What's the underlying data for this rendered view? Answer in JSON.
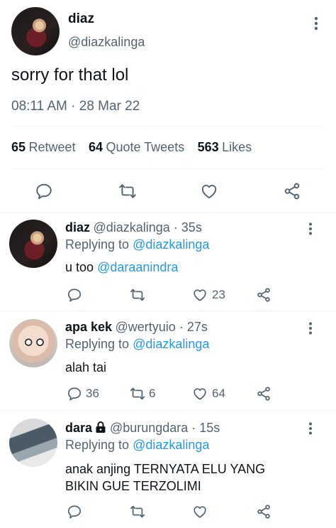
{
  "main_tweet": {
    "name": "diaz",
    "handle": "@diazkalinga",
    "text": "sorry for that lol",
    "timestamp": "08:11 AM · 28 Mar 22",
    "stats": {
      "retweets": "65",
      "retweets_label": "Retweet",
      "quotes": "64",
      "quotes_label": "Quote Tweets",
      "likes": "563",
      "likes_label": "Likes"
    }
  },
  "replies": [
    {
      "name": "diaz",
      "handle_time": "@diazkalinga · 35s",
      "replying_label": "Replying to",
      "replying_handle": "@diazkalinga",
      "text_prefix": "u too",
      "text_mention": "@daraanindra",
      "text": "",
      "counts": {
        "replies": "",
        "retweets": "",
        "likes": "23"
      }
    },
    {
      "name": "apa kek",
      "handle_time": "@wertyuio · 27s",
      "replying_label": "Replying to",
      "replying_handle": "@diazkalinga",
      "text": "alah tai",
      "counts": {
        "replies": "36",
        "retweets": "6",
        "likes": "64"
      }
    },
    {
      "name": "dara",
      "handle_time": "@burungdara · 15s",
      "replying_label": "Replying to",
      "replying_handle": "@diazkalinga",
      "text": "anak anjing TERNYATA ELU YANG BIKIN GUE TERZOLIMI",
      "protected": true,
      "counts": {
        "replies": "",
        "retweets": "",
        "likes": ""
      }
    }
  ],
  "icons": {
    "more": "more-vertical-icon",
    "reply": "reply-icon",
    "retweet": "retweet-icon",
    "like": "heart-icon",
    "share": "share-icon",
    "lock": "lock-icon"
  },
  "colors": {
    "link": "#1d9bf0",
    "secondary": "#536471",
    "text": "#0f1419"
  }
}
